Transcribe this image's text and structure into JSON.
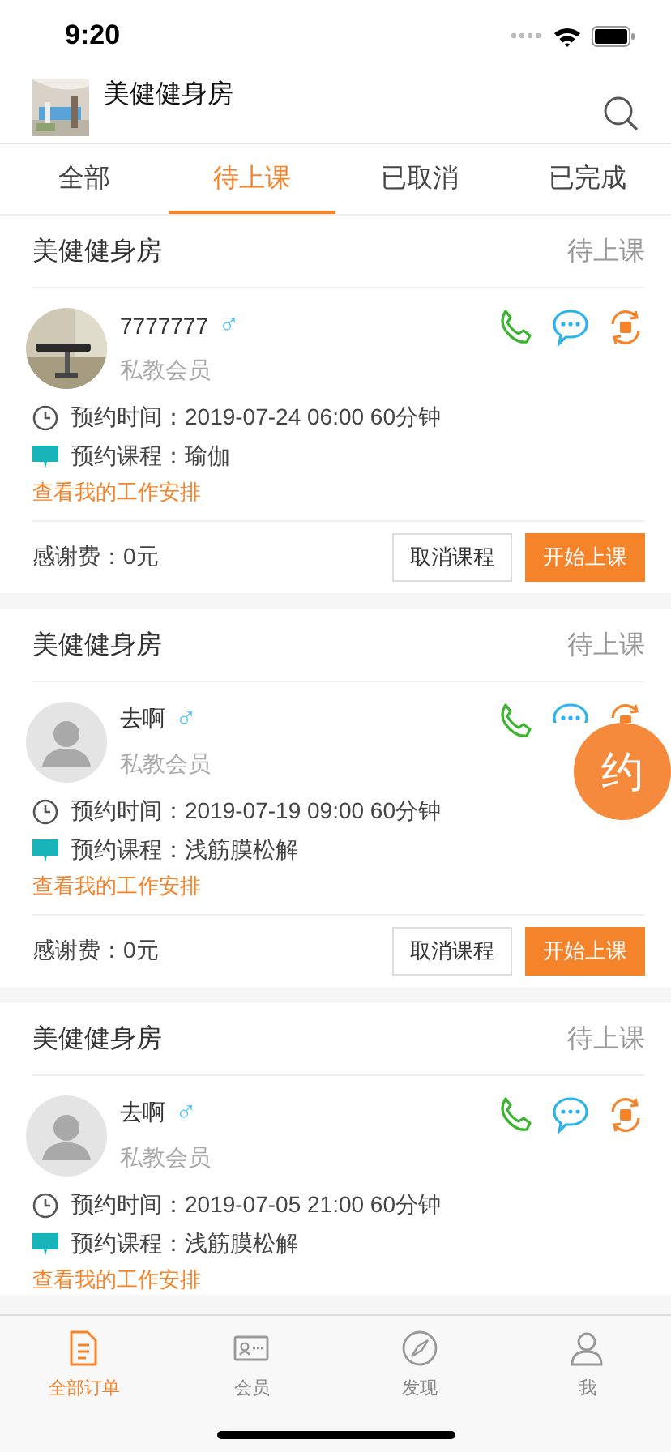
{
  "status_bar": {
    "time": "9:20"
  },
  "header": {
    "title": "美健健身房"
  },
  "tabs": [
    {
      "label": "全部",
      "selected": false
    },
    {
      "label": "待上课",
      "selected": true
    },
    {
      "label": "已取消",
      "selected": false
    },
    {
      "label": "已完成",
      "selected": false
    }
  ],
  "orders": [
    {
      "gym": "美健健身房",
      "status": "待上课",
      "member": {
        "name": "7777777",
        "gender": "♂",
        "role": "私教会员"
      },
      "time": "预约时间：2019-07-24 06:00  60分钟",
      "course": "预约课程：瑜伽",
      "link": "查看我的工作安排",
      "fee": "感谢费：0元",
      "buttons": [
        {
          "label": "取消课程",
          "kind": "outline"
        },
        {
          "label": "开始上课",
          "kind": "primary"
        }
      ]
    },
    {
      "gym": "美健健身房",
      "status": "待上课",
      "member": {
        "name": "去啊",
        "gender": "♂",
        "role": "私教会员",
        "avatar": {
          "kind": "placeholder"
        }
      },
      "time": "预约时间：2019-07-19 09:00  60分钟",
      "course": "预约课程：浅筋膜松解",
      "link": "查看我的工作安排",
      "fee": "感谢费：0元",
      "buttons": [
        {
          "label": "取消课程",
          "kind": "outline"
        },
        {
          "label": "开始上课",
          "kind": "primary"
        }
      ]
    },
    {
      "gym": "美健健身房",
      "status": "待上课",
      "member": {
        "name": "去啊",
        "gender": "♂",
        "role": "私教会员",
        "avatar": {
          "kind": "placeholder"
        }
      },
      "time": "预约时间：2019-07-05 21:00  60分钟",
      "course": "预约课程：浅筋膜松解",
      "link": "查看我的工作安排"
    }
  ],
  "fab": {
    "label": "约"
  },
  "bottom_nav": [
    {
      "label": "全部订单",
      "selected": true
    },
    {
      "label": "会员",
      "selected": false
    },
    {
      "label": "发现",
      "selected": false
    },
    {
      "label": "我",
      "selected": false
    }
  ]
}
